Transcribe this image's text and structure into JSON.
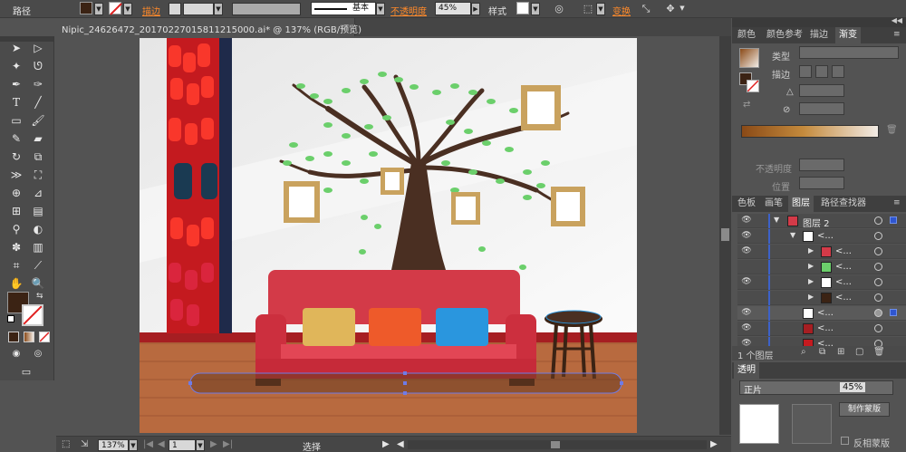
{
  "control_bar": {
    "object_type": "路径",
    "stroke_label": "描边",
    "stroke_style": "基本",
    "opacity_label": "不透明度",
    "opacity_value": "45%",
    "style_label": "样式",
    "transform_label": "变换",
    "fill_color": "#3b2314"
  },
  "document": {
    "tab_title": "Nipic_24626472_20170227015811215000.ai* @ 137% (RGB/预览)"
  },
  "status_bar": {
    "zoom": "137%",
    "page": "1",
    "tool": "选择"
  },
  "tool_panel": {
    "fill_color": "#3b2314",
    "tools": [
      "selection-tool",
      "direct-selection-tool",
      "magic-wand-tool",
      "lasso-tool",
      "pen-tool",
      "curvature-tool",
      "type-tool",
      "line-tool",
      "rectangle-tool",
      "paintbrush-tool",
      "pencil-tool",
      "eraser-tool",
      "rotate-tool",
      "scale-tool",
      "width-tool",
      "free-transform-tool",
      "shape-builder-tool",
      "perspective-tool",
      "mesh-tool",
      "gradient-tool",
      "eyedropper-tool",
      "blend-tool",
      "symbol-sprayer-tool",
      "column-graph-tool",
      "artboard-tool",
      "slice-tool",
      "hand-tool",
      "zoom-tool"
    ]
  },
  "gradient_panel": {
    "tabs": [
      "颜色",
      "颜色参考",
      "描边",
      "渐变"
    ],
    "active_tab": "渐变",
    "type_label": "类型",
    "stroke_label": "描边",
    "opacity_label": "不透明度",
    "position_label": "位置",
    "gradient_start": "#8a4a17",
    "gradient_end": "#f2ece6"
  },
  "layers_panel": {
    "tabs": [
      "色板",
      "画笔",
      "图层",
      "路径查找器"
    ],
    "active_tab": "图层",
    "rows": [
      {
        "name": "图层 2",
        "level": 0,
        "visible": true
      },
      {
        "name": "<...",
        "level": 1,
        "visible": true
      },
      {
        "name": "<...",
        "level": 2,
        "visible": true
      },
      {
        "name": "<...",
        "level": 2,
        "visible": false
      },
      {
        "name": "<...",
        "level": 2,
        "visible": true
      },
      {
        "name": "<...",
        "level": 2,
        "visible": false
      },
      {
        "name": "<...",
        "level": 2,
        "visible": true
      },
      {
        "name": "<...",
        "level": 2,
        "visible": true
      },
      {
        "name": "<...",
        "level": 2,
        "visible": true
      }
    ],
    "footer_count": "1 个图层"
  },
  "transparency_panel": {
    "tab_label": "透明",
    "blend_mode": "正片",
    "opacity_value": "45%",
    "make_mask_button": "制作蒙版",
    "invert_mask_label": "反相蒙版"
  },
  "artwork": {
    "wall_color": "#f0f0f0",
    "floor_color": "#b86a3f",
    "sofa_color": "#d33a48",
    "trunk_color": "#4a2f22",
    "leaf_color": "#6bcf6b",
    "frame_color": "#c9a25e",
    "curtain_color": "#c41a1f",
    "cushion_colors": [
      "#e0b65a",
      "#ee5a2a",
      "#2a96de"
    ]
  }
}
